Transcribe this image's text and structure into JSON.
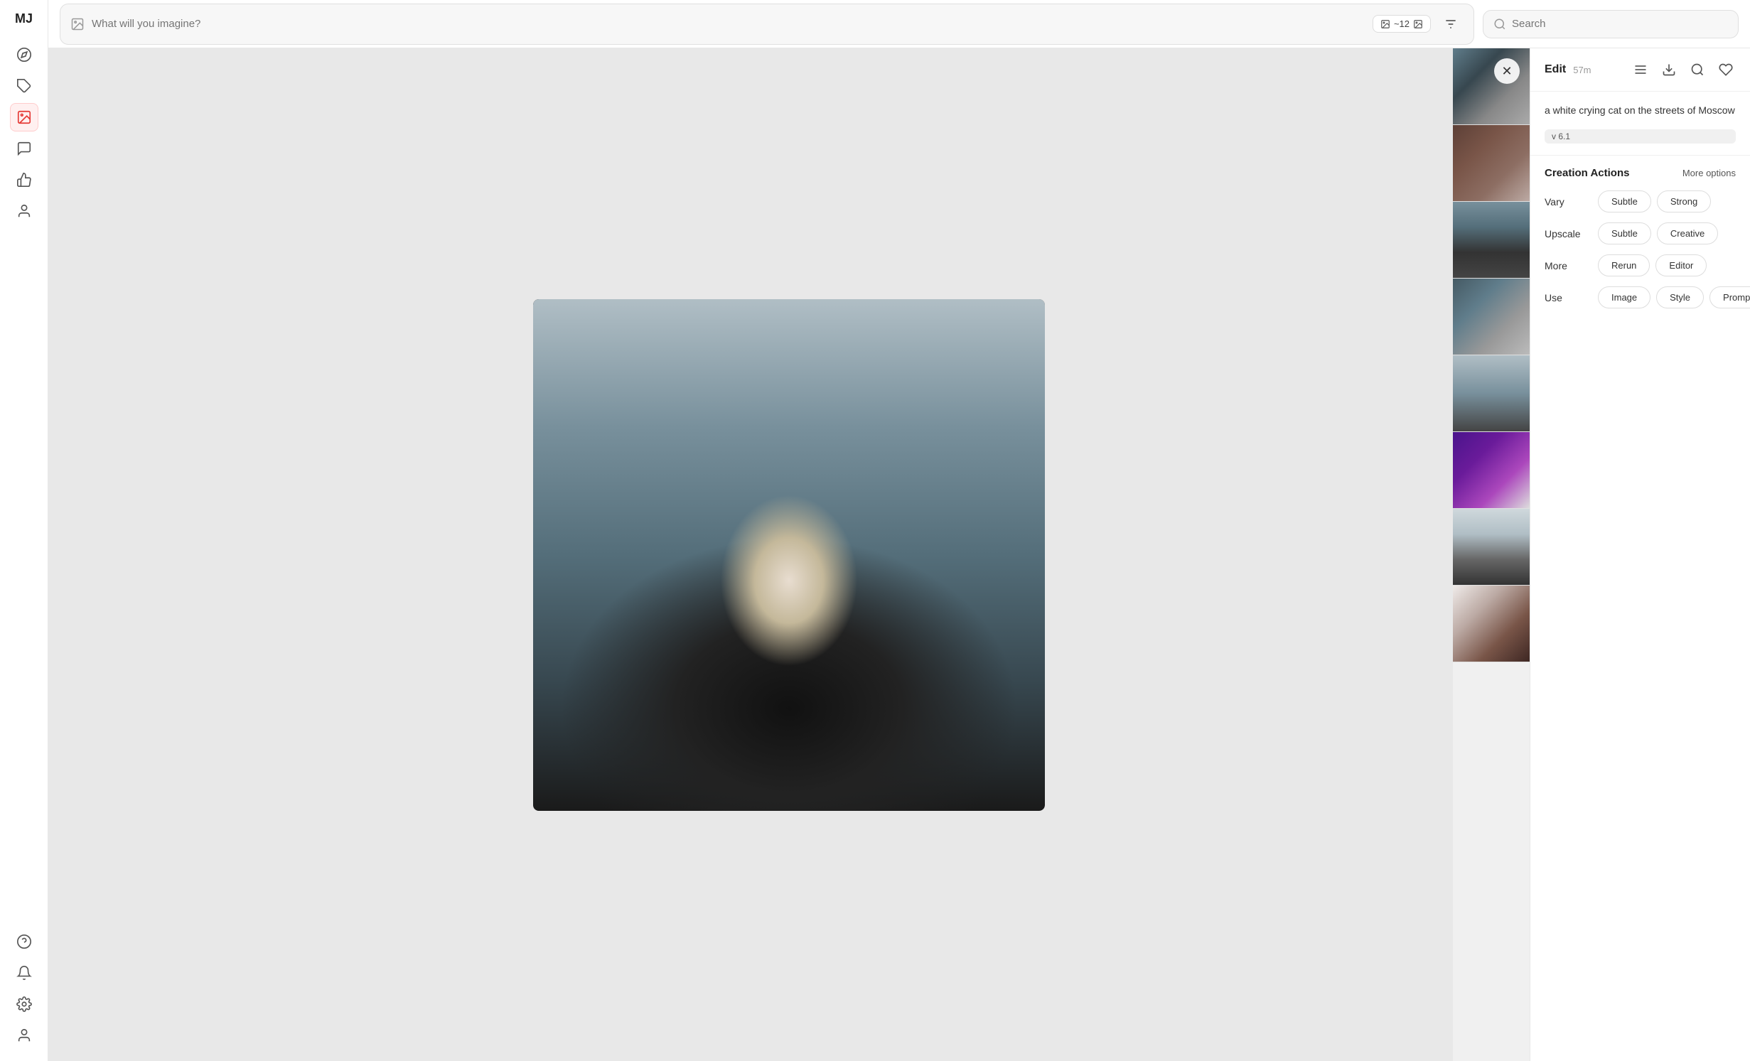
{
  "app": {
    "logo": "MJ"
  },
  "sidebar": {
    "items": [
      {
        "name": "compass",
        "icon": "◎",
        "active": false
      },
      {
        "name": "tag",
        "icon": "⊟",
        "active": false
      },
      {
        "name": "image",
        "icon": "⊞",
        "active": true
      },
      {
        "name": "chat",
        "icon": "⬡",
        "active": false
      },
      {
        "name": "thumbup",
        "icon": "⊕",
        "active": false
      },
      {
        "name": "person",
        "icon": "◉",
        "active": false
      }
    ],
    "bottom_items": [
      {
        "name": "help",
        "icon": "?"
      },
      {
        "name": "bell",
        "icon": "🔔"
      },
      {
        "name": "settings",
        "icon": "✦"
      },
      {
        "name": "profile",
        "icon": "◉"
      }
    ]
  },
  "topbar": {
    "prompt_placeholder": "What will you imagine?",
    "image_count": "~12",
    "search_placeholder": "Search"
  },
  "viewer": {
    "close_label": "✕"
  },
  "panel": {
    "title": "Edit",
    "time": "57m",
    "description": "a white crying cat on the streets of Moscow",
    "version": "v 6.1",
    "actions": {
      "title": "Creation Actions",
      "more_options": "More options",
      "vary": {
        "label": "Vary",
        "buttons": [
          "Subtle",
          "Strong"
        ]
      },
      "upscale": {
        "label": "Upscale",
        "buttons": [
          "Subtle",
          "Creative"
        ]
      },
      "more": {
        "label": "More",
        "buttons": [
          "Rerun",
          "Editor"
        ]
      },
      "use": {
        "label": "Use",
        "buttons": [
          "Image",
          "Style",
          "Prompt"
        ]
      }
    }
  }
}
